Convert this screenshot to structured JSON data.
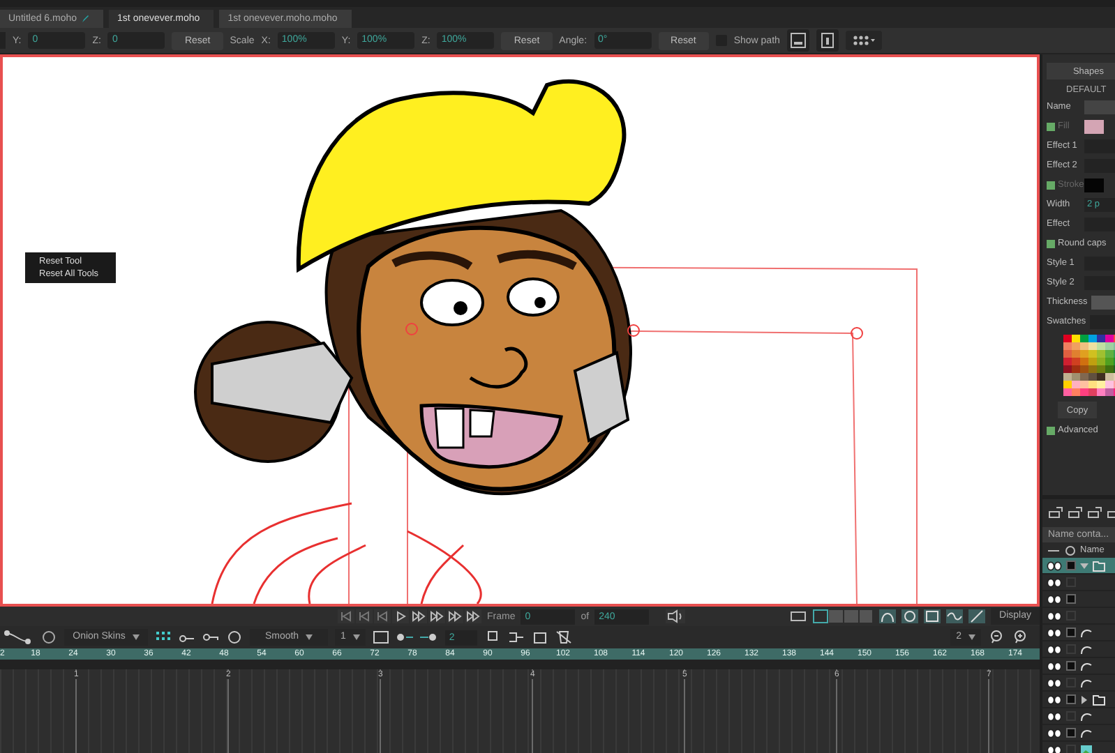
{
  "tabs": [
    {
      "label": "Untitled 6.moho",
      "selected": false,
      "modified": true
    },
    {
      "label": "1st onevever.moho",
      "selected": true,
      "modified": false
    },
    {
      "label": "1st onevever.moho.moho",
      "selected": false,
      "modified": false
    }
  ],
  "toolbar": [
    {
      "kind": "field",
      "label": "Y:",
      "value": "0"
    },
    {
      "kind": "field",
      "label": "Z:",
      "value": "0"
    },
    {
      "kind": "button",
      "label": "Reset"
    },
    {
      "kind": "label",
      "label": "Scale"
    },
    {
      "kind": "field",
      "label": "X:",
      "value": "100%"
    },
    {
      "kind": "field",
      "label": "Y:",
      "value": "100%"
    },
    {
      "kind": "field",
      "label": "Z:",
      "value": "100%"
    },
    {
      "kind": "button",
      "label": "Reset"
    },
    {
      "kind": "field",
      "label": "Angle:",
      "value": "0°"
    },
    {
      "kind": "button",
      "label": "Reset"
    },
    {
      "kind": "checkbox",
      "label": "Show path",
      "checked": false
    }
  ],
  "context_menu": {
    "items": [
      "Reset Tool",
      "Reset All Tools"
    ]
  },
  "playback": {
    "frame_label": "Frame",
    "frame": "0",
    "of_label": "of",
    "total": "240",
    "display": "Display"
  },
  "timeline_toolbar": {
    "onion_skins": "Onion Skins",
    "interpolation": "Smooth",
    "cycle": "1",
    "keys": "2",
    "zoom": "2"
  },
  "ruler": [
    "2",
    "18",
    "24",
    "30",
    "36",
    "42",
    "48",
    "54",
    "60",
    "66",
    "72",
    "78",
    "84",
    "90",
    "96",
    "102",
    "108",
    "114",
    "120",
    "126",
    "132",
    "138",
    "144",
    "150",
    "156",
    "162",
    "168",
    "174"
  ],
  "markers": [
    "1",
    "2",
    "3",
    "4",
    "5",
    "6",
    "7"
  ],
  "properties": {
    "tab": "Shapes",
    "preset": "DEFAULT",
    "rows": [
      {
        "kind": "field",
        "label": "Name",
        "value": ""
      },
      {
        "kind": "swatch",
        "label": "Fill",
        "checked": true,
        "disabled": true,
        "color": "#d4a5b4"
      },
      {
        "kind": "field",
        "label": "Effect 1"
      },
      {
        "kind": "field",
        "label": "Effect 2"
      },
      {
        "kind": "swatch",
        "label": "Stroke",
        "checked": true,
        "disabled": true,
        "color": "#050505"
      },
      {
        "kind": "field",
        "label": "Width",
        "value": "2 p"
      },
      {
        "kind": "field",
        "label": "Effect"
      },
      {
        "kind": "check",
        "label": "Round caps",
        "checked": true,
        "disabled": false
      },
      {
        "kind": "field",
        "label": "Style 1"
      },
      {
        "kind": "field",
        "label": "Style 2"
      },
      {
        "kind": "field",
        "label": "Thickness"
      },
      {
        "kind": "field",
        "label": "Swatches"
      }
    ],
    "copy": "Copy",
    "advanced": {
      "label": "Advanced",
      "checked": true
    }
  },
  "layers": {
    "search_placeholder": "Name conta...",
    "header": "Name",
    "rows": [
      {
        "kind": "group",
        "selected": true,
        "marked": true,
        "expanded": true
      },
      {
        "kind": "none",
        "selected": false,
        "marked": false
      },
      {
        "kind": "none",
        "selected": false,
        "marked": true
      },
      {
        "kind": "none",
        "selected": false,
        "marked": false
      },
      {
        "kind": "vector",
        "selected": false,
        "marked": true
      },
      {
        "kind": "vector",
        "selected": false,
        "marked": false
      },
      {
        "kind": "vector",
        "selected": false,
        "marked": true
      },
      {
        "kind": "vector",
        "selected": false,
        "marked": false
      },
      {
        "kind": "group",
        "selected": false,
        "marked": true,
        "expanded": false
      },
      {
        "kind": "vector",
        "selected": false,
        "marked": false
      },
      {
        "kind": "vector",
        "selected": false,
        "marked": true
      },
      {
        "kind": "image",
        "selected": false,
        "marked": false
      }
    ]
  }
}
